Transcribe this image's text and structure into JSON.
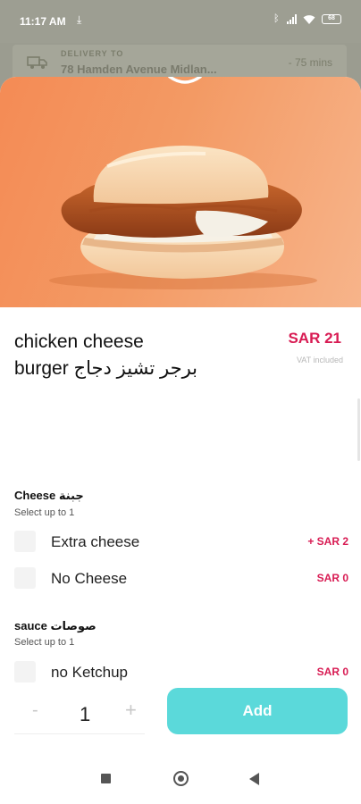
{
  "status_bar": {
    "time": "11:17 AM",
    "download_icon": "download-icon",
    "battery": "68"
  },
  "delivery": {
    "label": "DELIVERY TO",
    "address": "78 Hamden Avenue Midlan...",
    "eta": "- 75 mins"
  },
  "product": {
    "title": "chicken cheese burger برجر تشيز دجاج",
    "price": "SAR 21",
    "vat_note": "VAT included"
  },
  "groups": [
    {
      "title": "Cheese جبنة",
      "subtitle": "Select up to 1",
      "options": [
        {
          "label": "Extra cheese",
          "price": "+  SAR 2"
        },
        {
          "label": "No Cheese",
          "price": "SAR 0"
        }
      ]
    },
    {
      "title": "sauce صوصات",
      "subtitle": "Select up to 1",
      "options": [
        {
          "label": "no  Ketchup",
          "price": "SAR 0"
        }
      ]
    }
  ],
  "footer": {
    "minus": "-",
    "quantity": "1",
    "plus": "+",
    "add_label": "Add"
  },
  "colors": {
    "accent_price": "#d81b53",
    "add_button": "#5bd9da",
    "hero_background": "#f48b55"
  }
}
